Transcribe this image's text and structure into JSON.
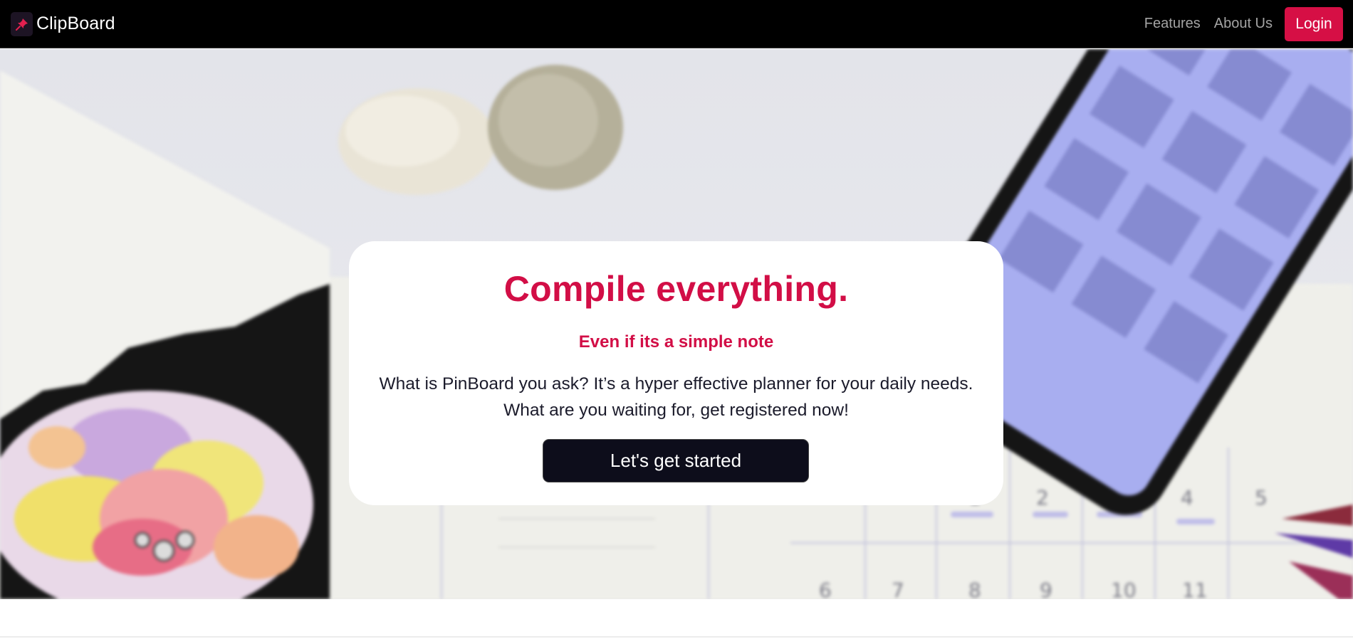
{
  "navbar": {
    "brand_name": "ClipBoard",
    "brand_icon": "pin-icon",
    "links": [
      {
        "label": "Features"
      },
      {
        "label": "About Us"
      }
    ],
    "login_label": "Login"
  },
  "hero": {
    "background_image": "desk-with-calendar-phone-stones-drawing"
  },
  "card": {
    "title": "Compile everything.",
    "subtitle": "Even if its a simple note",
    "body_line_1": "What is PinBoard you ask? It’s a hyper effective planner for your daily needs.",
    "body_line_2": "What are you waiting for, get registered now!",
    "cta_label": "Let's get started"
  },
  "colors": {
    "accent": "#d60f45",
    "navbar_bg": "#000000",
    "cta_bg": "#0d0d1b"
  }
}
